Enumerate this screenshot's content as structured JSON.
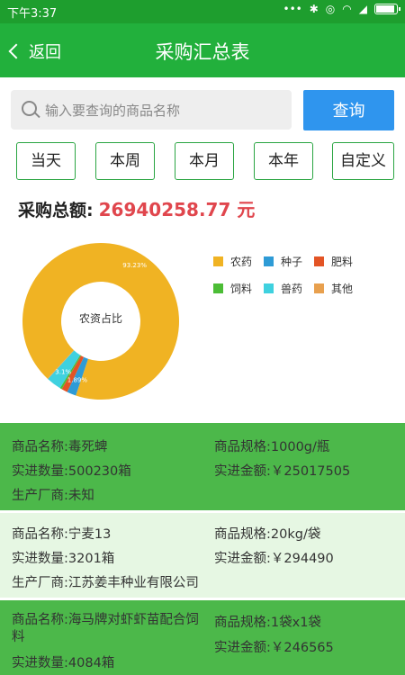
{
  "status": {
    "time": "下午3:37"
  },
  "appbar": {
    "back_label": "返回",
    "title": "采购汇总表"
  },
  "search": {
    "placeholder": "输入要查询的商品名称",
    "button_label": "查询"
  },
  "ranges": [
    "当天",
    "本周",
    "本月",
    "本年",
    "自定义"
  ],
  "total": {
    "label": "采购总额:",
    "amount": "26940258.77 元"
  },
  "chart_data": {
    "type": "pie",
    "center_label": "农资占比",
    "categories": [
      "农药",
      "种子",
      "肥料",
      "饲料",
      "兽药",
      "其他"
    ],
    "colors": [
      "#f0b323",
      "#2e9bd6",
      "#e35425",
      "#4cbd36",
      "#3fd1df",
      "#e8a04e"
    ],
    "values": [
      93.23,
      1.89,
      1.26,
      0.4,
      3.1,
      0.12
    ],
    "labels": [
      "93.23%",
      "1.89%",
      "",
      "",
      "3.1%",
      ""
    ]
  },
  "cards": [
    {
      "name_label": "商品名称:",
      "name": "毒死蜱",
      "spec_label": "商品规格:",
      "spec": "1000g/瓶",
      "qty_label": "实进数量:",
      "qty": "500230箱",
      "amount_label": "实进金额:",
      "amount": "￥25017505",
      "maker_label": "生产厂商:",
      "maker": "未知"
    },
    {
      "name_label": "商品名称:",
      "name": "宁麦13",
      "spec_label": "商品规格:",
      "spec": "20kg/袋",
      "qty_label": "实进数量:",
      "qty": "3201箱",
      "amount_label": "实进金额:",
      "amount": "￥294490",
      "maker_label": "生产厂商:",
      "maker": "江苏姜丰种业有限公司"
    },
    {
      "name_label": "商品名称:",
      "name": "海马牌对虾虾苗配合饲料",
      "spec_label": "商品规格:",
      "spec": "1袋x1袋",
      "qty_label": "实进数量:",
      "qty": "4084箱",
      "amount_label": "实进金额:",
      "amount": "￥246565"
    }
  ]
}
